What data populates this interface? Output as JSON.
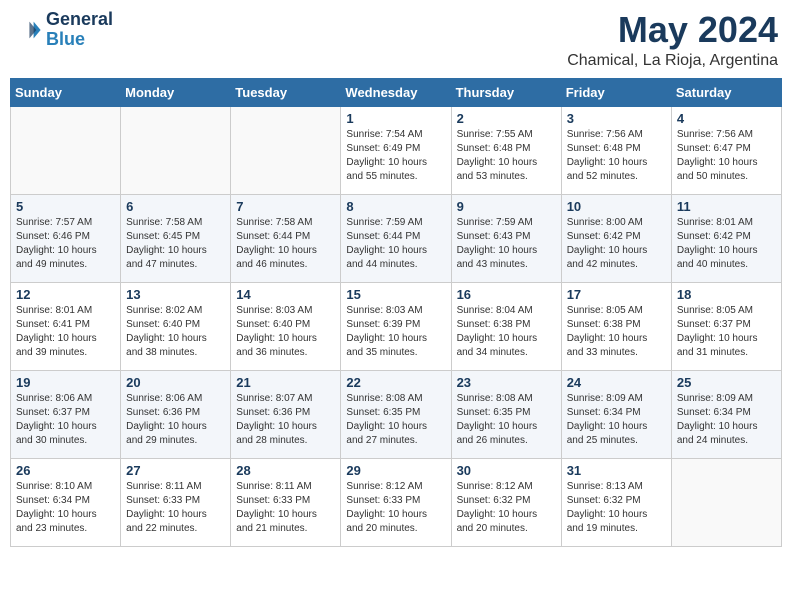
{
  "header": {
    "logo_line1": "General",
    "logo_line2": "Blue",
    "month_title": "May 2024",
    "subtitle": "Chamical, La Rioja, Argentina"
  },
  "weekdays": [
    "Sunday",
    "Monday",
    "Tuesday",
    "Wednesday",
    "Thursday",
    "Friday",
    "Saturday"
  ],
  "weeks": [
    [
      {
        "day": "",
        "sunrise": "",
        "sunset": "",
        "daylight": ""
      },
      {
        "day": "",
        "sunrise": "",
        "sunset": "",
        "daylight": ""
      },
      {
        "day": "",
        "sunrise": "",
        "sunset": "",
        "daylight": ""
      },
      {
        "day": "1",
        "sunrise": "Sunrise: 7:54 AM",
        "sunset": "Sunset: 6:49 PM",
        "daylight": "Daylight: 10 hours and 55 minutes."
      },
      {
        "day": "2",
        "sunrise": "Sunrise: 7:55 AM",
        "sunset": "Sunset: 6:48 PM",
        "daylight": "Daylight: 10 hours and 53 minutes."
      },
      {
        "day": "3",
        "sunrise": "Sunrise: 7:56 AM",
        "sunset": "Sunset: 6:48 PM",
        "daylight": "Daylight: 10 hours and 52 minutes."
      },
      {
        "day": "4",
        "sunrise": "Sunrise: 7:56 AM",
        "sunset": "Sunset: 6:47 PM",
        "daylight": "Daylight: 10 hours and 50 minutes."
      }
    ],
    [
      {
        "day": "5",
        "sunrise": "Sunrise: 7:57 AM",
        "sunset": "Sunset: 6:46 PM",
        "daylight": "Daylight: 10 hours and 49 minutes."
      },
      {
        "day": "6",
        "sunrise": "Sunrise: 7:58 AM",
        "sunset": "Sunset: 6:45 PM",
        "daylight": "Daylight: 10 hours and 47 minutes."
      },
      {
        "day": "7",
        "sunrise": "Sunrise: 7:58 AM",
        "sunset": "Sunset: 6:44 PM",
        "daylight": "Daylight: 10 hours and 46 minutes."
      },
      {
        "day": "8",
        "sunrise": "Sunrise: 7:59 AM",
        "sunset": "Sunset: 6:44 PM",
        "daylight": "Daylight: 10 hours and 44 minutes."
      },
      {
        "day": "9",
        "sunrise": "Sunrise: 7:59 AM",
        "sunset": "Sunset: 6:43 PM",
        "daylight": "Daylight: 10 hours and 43 minutes."
      },
      {
        "day": "10",
        "sunrise": "Sunrise: 8:00 AM",
        "sunset": "Sunset: 6:42 PM",
        "daylight": "Daylight: 10 hours and 42 minutes."
      },
      {
        "day": "11",
        "sunrise": "Sunrise: 8:01 AM",
        "sunset": "Sunset: 6:42 PM",
        "daylight": "Daylight: 10 hours and 40 minutes."
      }
    ],
    [
      {
        "day": "12",
        "sunrise": "Sunrise: 8:01 AM",
        "sunset": "Sunset: 6:41 PM",
        "daylight": "Daylight: 10 hours and 39 minutes."
      },
      {
        "day": "13",
        "sunrise": "Sunrise: 8:02 AM",
        "sunset": "Sunset: 6:40 PM",
        "daylight": "Daylight: 10 hours and 38 minutes."
      },
      {
        "day": "14",
        "sunrise": "Sunrise: 8:03 AM",
        "sunset": "Sunset: 6:40 PM",
        "daylight": "Daylight: 10 hours and 36 minutes."
      },
      {
        "day": "15",
        "sunrise": "Sunrise: 8:03 AM",
        "sunset": "Sunset: 6:39 PM",
        "daylight": "Daylight: 10 hours and 35 minutes."
      },
      {
        "day": "16",
        "sunrise": "Sunrise: 8:04 AM",
        "sunset": "Sunset: 6:38 PM",
        "daylight": "Daylight: 10 hours and 34 minutes."
      },
      {
        "day": "17",
        "sunrise": "Sunrise: 8:05 AM",
        "sunset": "Sunset: 6:38 PM",
        "daylight": "Daylight: 10 hours and 33 minutes."
      },
      {
        "day": "18",
        "sunrise": "Sunrise: 8:05 AM",
        "sunset": "Sunset: 6:37 PM",
        "daylight": "Daylight: 10 hours and 31 minutes."
      }
    ],
    [
      {
        "day": "19",
        "sunrise": "Sunrise: 8:06 AM",
        "sunset": "Sunset: 6:37 PM",
        "daylight": "Daylight: 10 hours and 30 minutes."
      },
      {
        "day": "20",
        "sunrise": "Sunrise: 8:06 AM",
        "sunset": "Sunset: 6:36 PM",
        "daylight": "Daylight: 10 hours and 29 minutes."
      },
      {
        "day": "21",
        "sunrise": "Sunrise: 8:07 AM",
        "sunset": "Sunset: 6:36 PM",
        "daylight": "Daylight: 10 hours and 28 minutes."
      },
      {
        "day": "22",
        "sunrise": "Sunrise: 8:08 AM",
        "sunset": "Sunset: 6:35 PM",
        "daylight": "Daylight: 10 hours and 27 minutes."
      },
      {
        "day": "23",
        "sunrise": "Sunrise: 8:08 AM",
        "sunset": "Sunset: 6:35 PM",
        "daylight": "Daylight: 10 hours and 26 minutes."
      },
      {
        "day": "24",
        "sunrise": "Sunrise: 8:09 AM",
        "sunset": "Sunset: 6:34 PM",
        "daylight": "Daylight: 10 hours and 25 minutes."
      },
      {
        "day": "25",
        "sunrise": "Sunrise: 8:09 AM",
        "sunset": "Sunset: 6:34 PM",
        "daylight": "Daylight: 10 hours and 24 minutes."
      }
    ],
    [
      {
        "day": "26",
        "sunrise": "Sunrise: 8:10 AM",
        "sunset": "Sunset: 6:34 PM",
        "daylight": "Daylight: 10 hours and 23 minutes."
      },
      {
        "day": "27",
        "sunrise": "Sunrise: 8:11 AM",
        "sunset": "Sunset: 6:33 PM",
        "daylight": "Daylight: 10 hours and 22 minutes."
      },
      {
        "day": "28",
        "sunrise": "Sunrise: 8:11 AM",
        "sunset": "Sunset: 6:33 PM",
        "daylight": "Daylight: 10 hours and 21 minutes."
      },
      {
        "day": "29",
        "sunrise": "Sunrise: 8:12 AM",
        "sunset": "Sunset: 6:33 PM",
        "daylight": "Daylight: 10 hours and 20 minutes."
      },
      {
        "day": "30",
        "sunrise": "Sunrise: 8:12 AM",
        "sunset": "Sunset: 6:32 PM",
        "daylight": "Daylight: 10 hours and 20 minutes."
      },
      {
        "day": "31",
        "sunrise": "Sunrise: 8:13 AM",
        "sunset": "Sunset: 6:32 PM",
        "daylight": "Daylight: 10 hours and 19 minutes."
      },
      {
        "day": "",
        "sunrise": "",
        "sunset": "",
        "daylight": ""
      }
    ]
  ]
}
